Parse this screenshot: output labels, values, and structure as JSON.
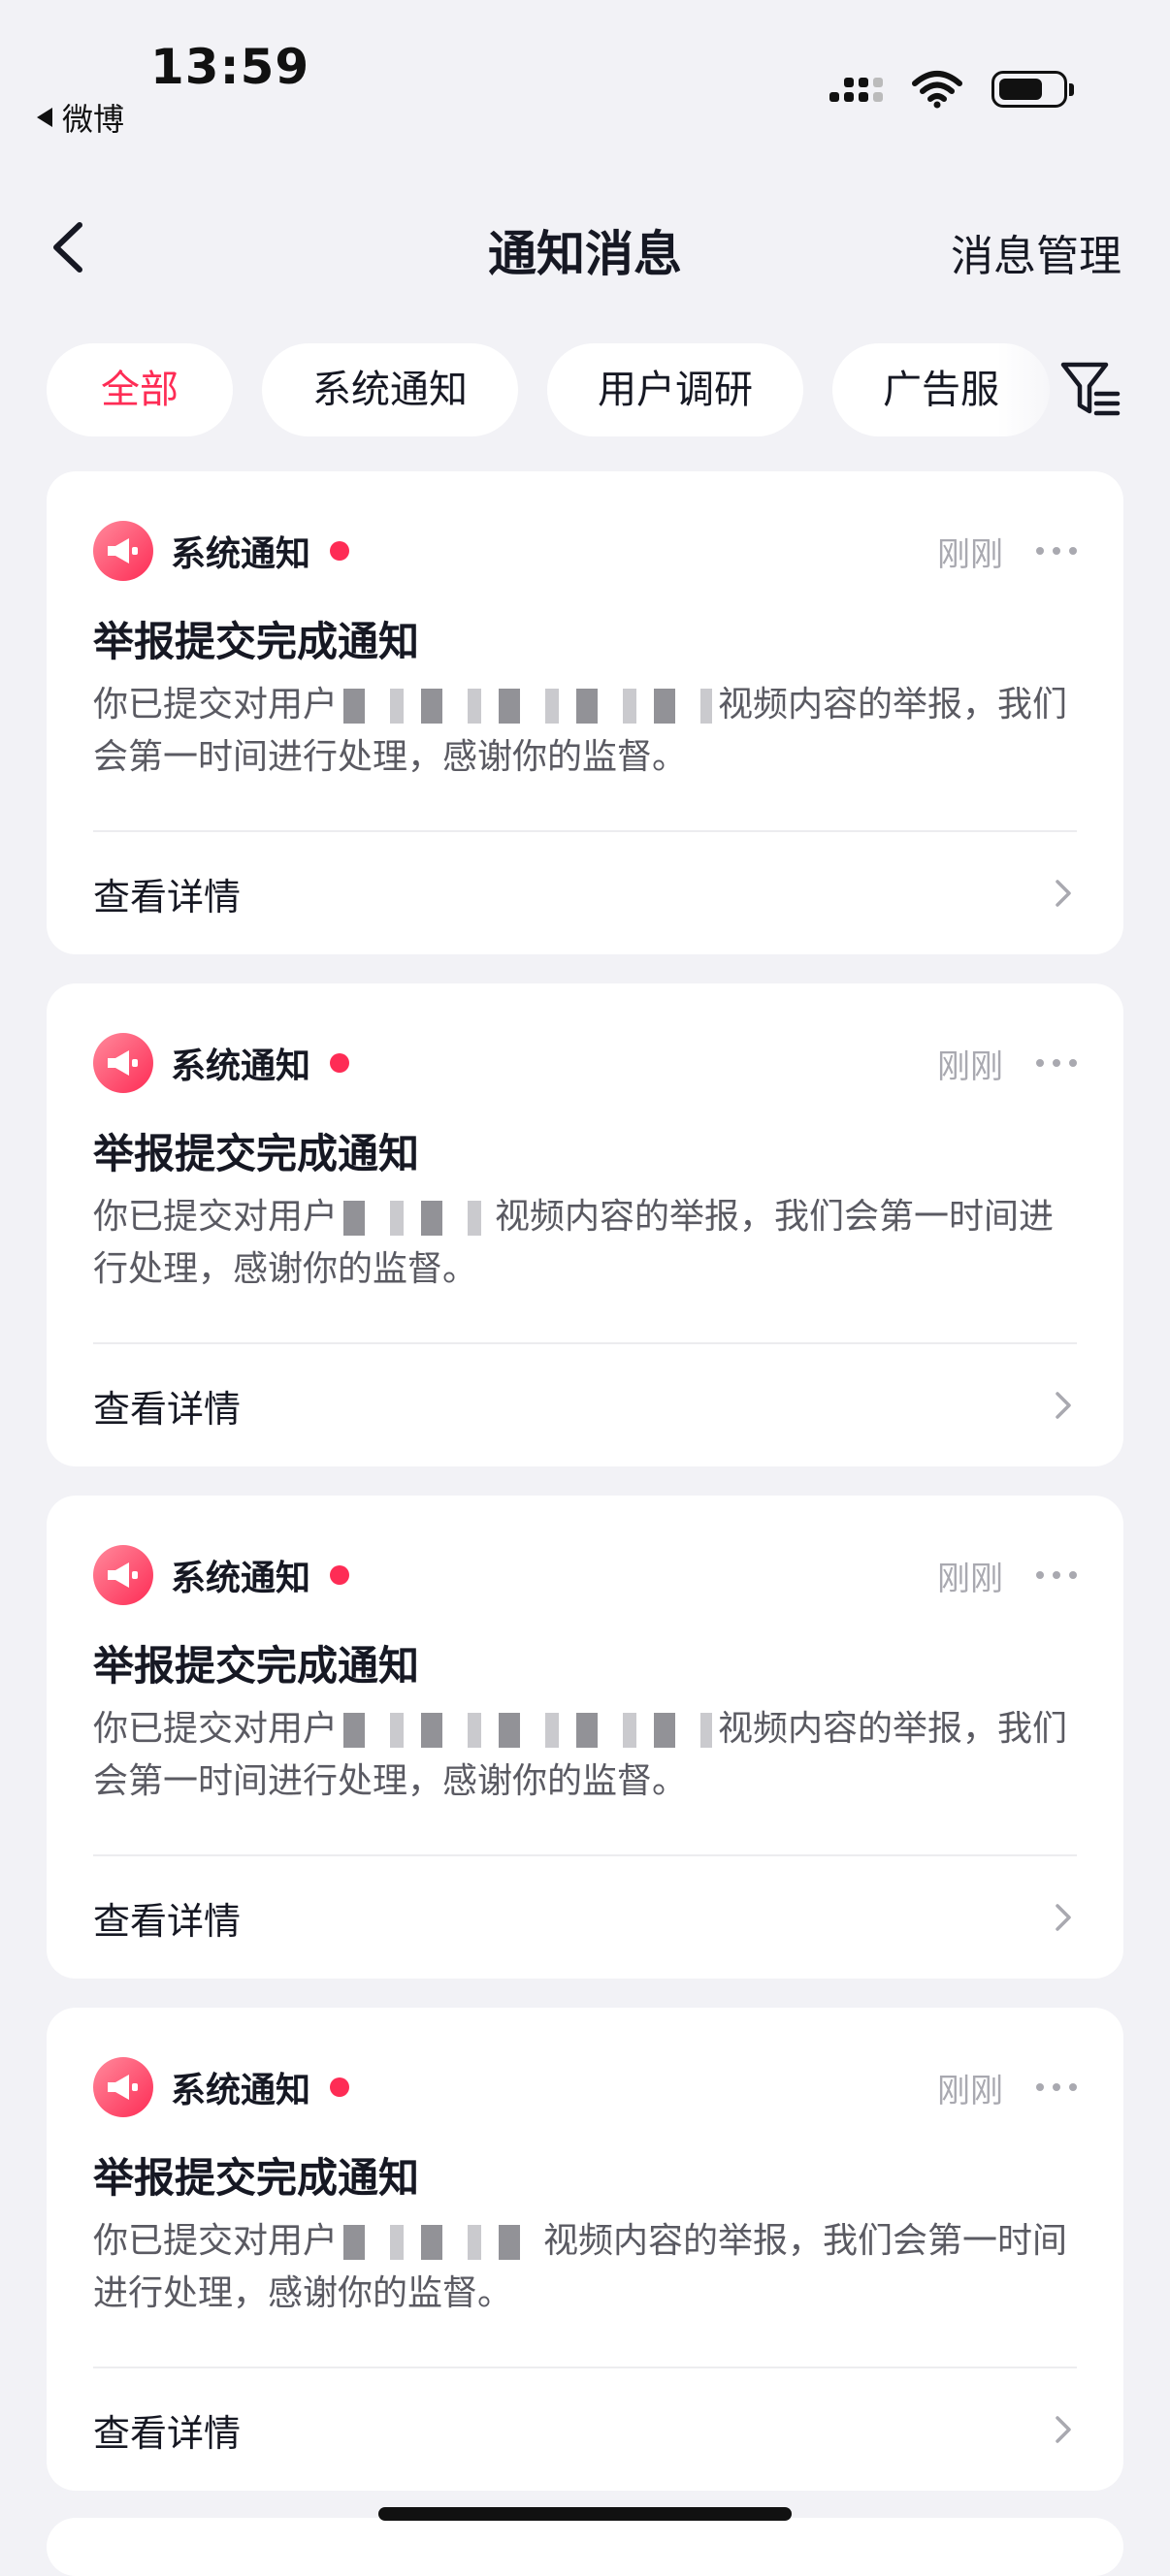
{
  "status_bar": {
    "time": "13:59",
    "back_app": "微博",
    "icons": [
      "cellular-signal-icon",
      "wifi-icon",
      "battery-icon"
    ]
  },
  "nav": {
    "title": "通知消息",
    "manage": "消息管理"
  },
  "tabs": [
    {
      "label": "全部",
      "active": true
    },
    {
      "label": "系统通知",
      "active": false
    },
    {
      "label": "用户调研",
      "active": false
    },
    {
      "label": "广告服",
      "active": false
    }
  ],
  "colors": {
    "accent": "#fe2c55",
    "background": "#f2f2f6",
    "muted": "#a9a9b0"
  },
  "notifications": [
    {
      "source": "系统通知",
      "time": "刚刚",
      "title": "举报提交完成通知",
      "body_prefix": "你已提交对用户",
      "body_suffix": "视频内容的举报，我们会第一时间进行处理，感谢你的监督。",
      "action": "查看详情"
    },
    {
      "source": "系统通知",
      "time": "刚刚",
      "title": "举报提交完成通知",
      "body_prefix": "你已提交对用户",
      "body_suffix": "视频内容的举报，我们会第一时间进行处理，感谢你的监督。",
      "action": "查看详情"
    },
    {
      "source": "系统通知",
      "time": "刚刚",
      "title": "举报提交完成通知",
      "body_prefix": "你已提交对用户",
      "body_suffix": "视频内容的举报，我们会第一时间进行处理，感谢你的监督。",
      "action": "查看详情"
    },
    {
      "source": "系统通知",
      "time": "刚刚",
      "title": "举报提交完成通知",
      "body_prefix": "你已提交对用户",
      "body_suffix": "视频内容的举报，我们会第一时间进行处理，感谢你的监督。",
      "action": "查看详情"
    }
  ]
}
